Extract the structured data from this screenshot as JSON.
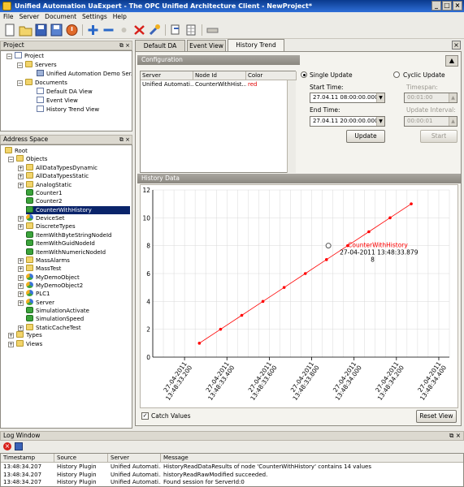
{
  "window": {
    "title": "Unified Automation UaExpert - The OPC Unified Architecture Client - NewProject*"
  },
  "menu": [
    "File",
    "Server",
    "Document",
    "Settings",
    "Help"
  ],
  "project": {
    "header": "Project",
    "items": [
      "Project",
      "Servers",
      "Unified Automation Demo Ser...",
      "Documents",
      "Default DA View",
      "Event View",
      "History Trend View"
    ]
  },
  "address_space": {
    "header": "Address Space",
    "root": "Root",
    "objects": "Objects",
    "items": [
      "AllDataTypesDynamic",
      "AllDataTypesStatic",
      "AnalogStatic",
      "Counter1",
      "Counter2",
      "CounterWithHistory",
      "DeviceSet",
      "DiscreteTypes",
      "ItemWithByteStringNodeId",
      "ItemWithGuidNodeId",
      "ItemWithNumericNodeId",
      "MassAlarms",
      "MassTest",
      "MyDemoObject",
      "MyDemoObject2",
      "PLC1",
      "Server",
      "SimulationActivate",
      "SimulationSpeed",
      "StaticCacheTest"
    ],
    "types": "Types",
    "views": "Views"
  },
  "tabs": [
    "Default DA View",
    "Event View",
    "History Trend View"
  ],
  "config": {
    "header": "Configuration",
    "columns": [
      "Server",
      "Node Id",
      "Color"
    ],
    "row": {
      "server": "Unified Automati...",
      "node": "CounterWithHist...",
      "color": "red"
    },
    "single_update": "Single Update",
    "cyclic_update": "Cyclic Update",
    "start_time_label": "Start Time:",
    "start_time": "27.04.11 08:00:00.000",
    "end_time_label": "End Time:",
    "end_time": "27.04.11 20:00:00.000",
    "update_button": "Update",
    "timespan_label": "Timespan:",
    "timespan": "00:01:00",
    "interval_label": "Update Interval:",
    "interval": "00:00:01",
    "start_button": "Start"
  },
  "history": {
    "header": "History Data",
    "catch_values": "Catch Values",
    "reset_view": "Reset View",
    "tooltip_series": "CounterWithHistory",
    "tooltip_time": "27-04-2011 13:48:33.879",
    "tooltip_value": "8"
  },
  "chart_data": {
    "type": "line",
    "series": [
      {
        "name": "CounterWithHistory",
        "color": "#ff0000",
        "x": [
          "27-04-2011 13:48:33.270",
          "27-04-2011 13:48:33.370",
          "27-04-2011 13:48:33.470",
          "27-04-2011 13:48:33.570",
          "27-04-2011 13:48:33.670",
          "27-04-2011 13:48:33.770",
          "27-04-2011 13:48:33.870",
          "27-04-2011 13:48:33.970",
          "27-04-2011 13:48:34.070",
          "27-04-2011 13:48:34.170",
          "27-04-2011 13:48:34.270"
        ],
        "values": [
          1,
          2,
          3,
          4,
          5,
          6,
          7,
          8,
          9,
          10,
          11
        ]
      }
    ],
    "ylim": [
      0,
      12
    ],
    "yticks": [
      0,
      2,
      4,
      6,
      8,
      10,
      12
    ],
    "xticks": [
      "27-04-2011 13:48:33.200",
      "27-04-2011 13:48:33.400",
      "27-04-2011 13:48:33.600",
      "27-04-2011 13:48:33.800",
      "27-04-2011 13:48:34.000",
      "27-04-2011 13:48:34.200",
      "27-04-2011 13:48:34.400"
    ],
    "grid": true
  },
  "log": {
    "header": "Log Window",
    "columns": [
      "Timestamp",
      "Source",
      "Server",
      "Message"
    ],
    "rows": [
      [
        "13:48:34.207",
        "History Plugin",
        "Unified Automati...",
        "HistoryReadDataResults of node 'CounterWithHistory' contains 14 values"
      ],
      [
        "13:48:34.207",
        "History Plugin",
        "Unified Automati...",
        "historyReadRawModified succeeded."
      ],
      [
        "13:48:34.207",
        "History Plugin",
        "Unified Automati...",
        "Found session for ServerId:0"
      ]
    ]
  }
}
